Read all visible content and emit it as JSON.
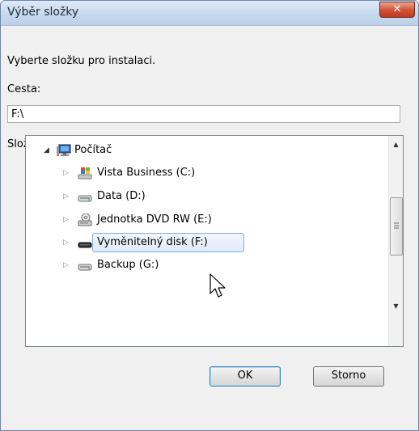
{
  "window": {
    "title": "Výběr složky",
    "close_symbol": "✕"
  },
  "instruction": "Vyberte složku pro instalaci.",
  "path": {
    "label": "Cesta:",
    "value": "F:\\"
  },
  "folders": {
    "label": "Složky:",
    "root": {
      "label": "Počítač",
      "icon": "computer-icon"
    },
    "items": [
      {
        "label": "Vista Business (C:)",
        "icon": "windows-drive-icon"
      },
      {
        "label": "Data (D:)",
        "icon": "hard-drive-icon"
      },
      {
        "label": "Jednotka DVD RW (E:)",
        "icon": "dvd-drive-icon"
      },
      {
        "label": "Vyměnitelný disk (F:)",
        "icon": "removable-disk-icon",
        "selected": true
      },
      {
        "label": "Backup (G:)",
        "icon": "hard-drive-icon"
      }
    ]
  },
  "buttons": {
    "ok": "OK",
    "cancel": "Storno"
  }
}
